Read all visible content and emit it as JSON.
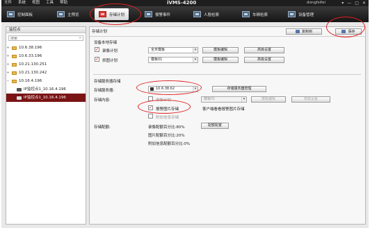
{
  "titlebar": {
    "menu": [
      "文件",
      "系统",
      "视图",
      "工具",
      "帮助"
    ],
    "app_title": "iVMS-4200",
    "user": "dongfsifei",
    "win_buttons": [
      "▾",
      "—",
      "□",
      "✕"
    ]
  },
  "tabs": [
    {
      "label": "控制面板",
      "icon": "control-panel-icon"
    },
    {
      "label": "主预览",
      "icon": "main-preview-icon"
    },
    {
      "label": "存储计划",
      "icon": "storage-plan-icon",
      "active": true
    },
    {
      "label": "报警事件",
      "icon": "alarm-event-icon"
    },
    {
      "label": "人脸检索",
      "icon": "face-search-icon"
    },
    {
      "label": "车辆检索",
      "icon": "vehicle-search-icon"
    },
    {
      "label": "设备管理",
      "icon": "device-management-icon"
    }
  ],
  "sidebar": {
    "title": "监控点",
    "search_placeholder": "搜索",
    "items": [
      {
        "label": "10.6.38.196",
        "type": "folder"
      },
      {
        "label": "10.6.33.196",
        "type": "folder"
      },
      {
        "label": "10.21.130.251",
        "type": "folder"
      },
      {
        "label": "10.21.130.242",
        "type": "folder"
      },
      {
        "label": "10.16.4.196",
        "type": "folder",
        "expanded": true
      },
      {
        "label": "IP监控点1_10.16.4.196",
        "type": "camera"
      },
      {
        "label": "IP监控点1_10.16.4.196",
        "type": "camera",
        "selected": true
      }
    ]
  },
  "main": {
    "title": "存储计划",
    "copy_button": "复制到",
    "save_button": "保存",
    "local_section": "设备本地存储",
    "record_plan": {
      "label": "录像计划",
      "checked": true,
      "template": "全天模板",
      "edit_button": "模板编辑",
      "advanced_button": "高级设置"
    },
    "capture_plan": {
      "label": "抓图计划",
      "checked": true,
      "template": "模板01",
      "edit_button": "模板编辑",
      "advanced_button": "高级设置"
    },
    "server_section": "存储服务器存储",
    "server_label": "存储服务器:",
    "server_value": "10.6.38.62",
    "server_manage_button": "存储服务器管理",
    "content_label": "存储内容:",
    "content_record": {
      "label": "录像计划",
      "checked": false,
      "template": "模板01",
      "edit_button": "模板编辑",
      "advanced_button": "高级设置"
    },
    "alarm_pic": {
      "label": "报警图片存储",
      "checked": true,
      "note": "客户端看看报警图片存储"
    },
    "extra_info": {
      "label": "附加信息存储",
      "checked": false
    },
    "quota_label": "存储配额:",
    "quota_record": "录像配额百分比:80%",
    "quota_picture": "图片配额百分比:20%",
    "quota_extra": "附加信息配额百分比:0%",
    "quota_button": "配额配置"
  }
}
